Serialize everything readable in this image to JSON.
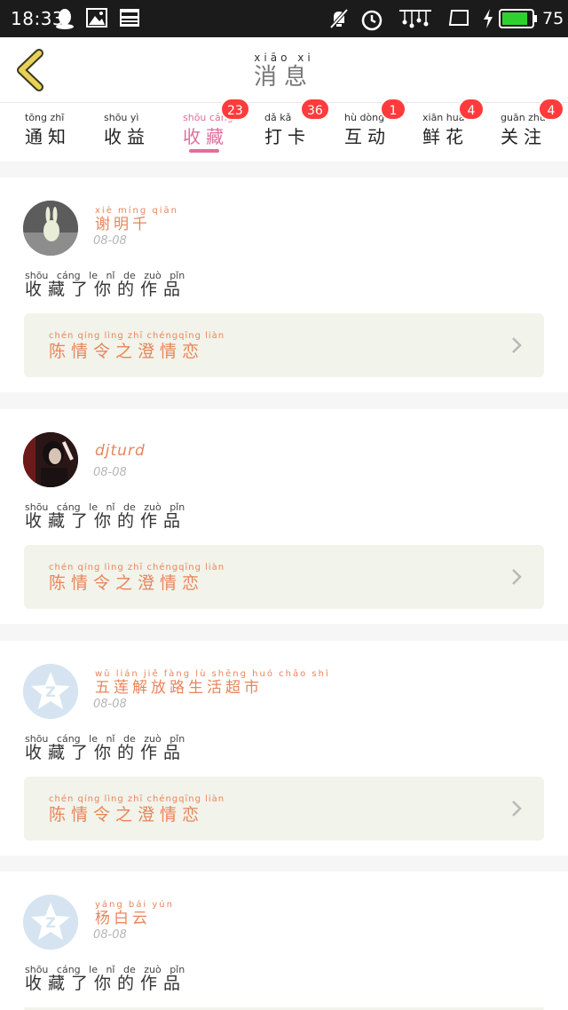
{
  "status_bar": {
    "time": "18:33",
    "battery": "75",
    "battery_color": "#2fd12f"
  },
  "header": {
    "title_pinyin": "xiāo xi",
    "title": "消息"
  },
  "tabs": [
    {
      "pinyin": "tōng zhī",
      "label": "通知",
      "badge": "",
      "active": false
    },
    {
      "pinyin": "shōu yì",
      "label": "收益",
      "badge": "",
      "active": false
    },
    {
      "pinyin": "shōu cáng",
      "label": "收藏",
      "badge": "23",
      "active": true
    },
    {
      "pinyin": "dǎ kǎ",
      "label": "打卡",
      "badge": "36",
      "active": false
    },
    {
      "pinyin": "hù dòng",
      "label": "互动",
      "badge": "1",
      "active": false
    },
    {
      "pinyin": "xiān huā",
      "label": "鲜花",
      "badge": "4",
      "active": false
    },
    {
      "pinyin": "guān zhù",
      "label": "关注",
      "badge": "4",
      "active": false
    }
  ],
  "notifications": [
    {
      "name_pinyin": "xiè míng qiān",
      "name": "谢明千",
      "date": "08-08",
      "action_pinyin": "shōu cáng le nǐ de zuò pǐn",
      "action": "收藏了你的作品",
      "work_pinyin": "chén qíng lìng zhī chéngqīng liàn",
      "work_title": "陈情令之澄情恋",
      "avatar": "rabbit"
    },
    {
      "name_pinyin": "",
      "name": "djturd",
      "date": "08-08",
      "action_pinyin": "shōu cáng le nǐ de zuò pǐn",
      "action": "收藏了你的作品",
      "work_pinyin": "chén qíng lìng zhī chéngqīng liàn",
      "work_title": "陈情令之澄情恋",
      "avatar": "photo"
    },
    {
      "name_pinyin": "wǔ lián jiě fàng lù shēng huó chāo shì",
      "name": "五莲解放路生活超市",
      "date": "08-08",
      "action_pinyin": "shōu cáng le nǐ de zuò pǐn",
      "action": "收藏了你的作品",
      "work_pinyin": "chén qíng lìng zhī chéngqīng liàn",
      "work_title": "陈情令之澄情恋",
      "avatar": "default"
    },
    {
      "name_pinyin": "yáng bái yún",
      "name": "杨白云",
      "date": "08-08",
      "action_pinyin": "shōu cáng le nǐ de zuò pǐn",
      "action": "收藏了你的作品",
      "work_pinyin": "",
      "work_title": "",
      "avatar": "default"
    }
  ],
  "colors": {
    "accent_pink": "#e06f9a",
    "badge_red": "#ff3b3b",
    "name_orange": "#e8855a",
    "work_bg": "#f2f3ea",
    "back_arrow": "#e8d05a"
  }
}
